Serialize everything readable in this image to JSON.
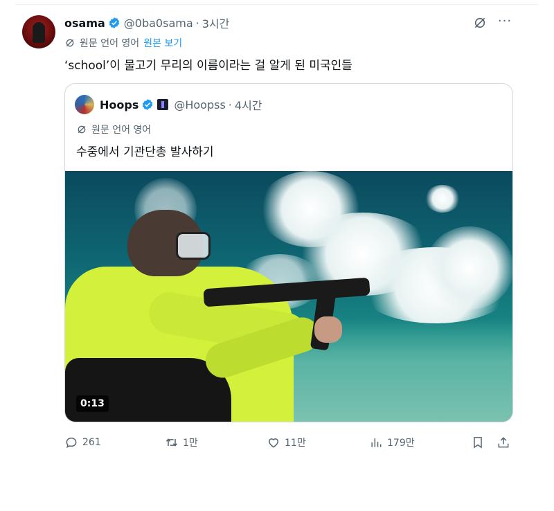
{
  "post": {
    "author_name": "osama",
    "author_handle": "@0ba0sama",
    "separator": "·",
    "time": "3시간",
    "translation_label": "원문 언어 영어",
    "show_original": "원본 보기",
    "text": "‘school’이 물고기 무리의 이름이라는 걸 알게 된 미국인들",
    "more": "···"
  },
  "quote": {
    "author_name": "Hoops",
    "author_handle": "@Hoopss",
    "separator": "·",
    "time": "4시간",
    "translation_label": "원문 언어 영어",
    "text": "수중에서 기관단총 발사하기",
    "video_duration": "0:13"
  },
  "actions": {
    "replies": "261",
    "retweets": "1만",
    "likes": "11만",
    "views": "179만"
  },
  "colors": {
    "accent": "#1d9bf0",
    "secondary_text": "#536471",
    "border": "#cfd9de"
  },
  "icons": [
    "verified-badge-icon",
    "grok-icon",
    "more-icon",
    "translate-icon",
    "reply-icon",
    "retweet-icon",
    "like-icon",
    "views-icon",
    "bookmark-icon",
    "share-icon"
  ]
}
